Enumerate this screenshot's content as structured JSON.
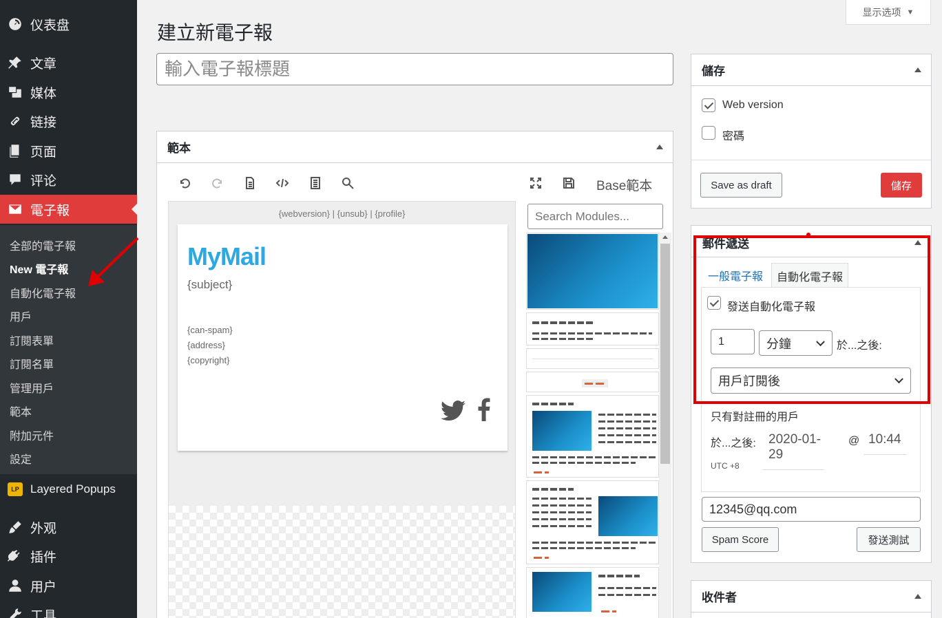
{
  "sidebar": {
    "menu": [
      {
        "label": "仪表盘",
        "icon": "dashboard-icon"
      },
      {
        "label": "文章",
        "icon": "pin-icon"
      },
      {
        "label": "媒体",
        "icon": "media-icon"
      },
      {
        "label": "链接",
        "icon": "link-icon"
      },
      {
        "label": "页面",
        "icon": "page-icon"
      },
      {
        "label": "评论",
        "icon": "comment-icon"
      },
      {
        "label": "電子報",
        "icon": "mail-icon"
      }
    ],
    "submenu": [
      "全部的電子報",
      "New 電子報",
      "自動化電子報",
      "用戶",
      "訂閱表單",
      "訂閱名單",
      "管理用戶",
      "範本",
      "附加元件",
      "設定"
    ],
    "layered_popups": {
      "label": "Layered Popups",
      "badge": "LP"
    },
    "menu_bottom": [
      {
        "label": "外观",
        "icon": "brush-icon"
      },
      {
        "label": "插件",
        "icon": "plugin-icon"
      },
      {
        "label": "用户",
        "icon": "user-icon"
      },
      {
        "label": "工具",
        "icon": "wrench-icon"
      }
    ]
  },
  "header": {
    "screen_options": "显示选项",
    "page_title": "建立新電子報",
    "title_placeholder": "輸入電子報標題"
  },
  "template": {
    "box_title": "範本",
    "base_label": "Base範本",
    "canvas_header": "{webversion} | {unsub} | {profile}",
    "logo": "MyMail",
    "subject": "{subject}",
    "footer_lines": [
      "{can-spam}",
      "{address}",
      "{copyright}"
    ],
    "search_placeholder": "Search Modules..."
  },
  "save": {
    "title": "儲存",
    "web_version": "Web version",
    "password": "密碼",
    "save_draft": "Save as draft",
    "save": "儲存"
  },
  "delivery": {
    "title": "郵件遞送",
    "tabs": [
      "一般電子報",
      "自動化電子報"
    ],
    "auto_send_label": "發送自動化電子報",
    "amount": "1",
    "unit": "分鐘",
    "after_label": "於...之後:",
    "trigger": "用戶訂閱後",
    "only_registered": "只有對註冊的用戶",
    "after_label2": "於...之後:",
    "date": "2020-01-29",
    "at": "@",
    "time": "10:44",
    "timezone": "UTC +8",
    "test_email": "12345@qq.com",
    "spam_score": "Spam Score",
    "send_test": "發送測試"
  },
  "recipients": {
    "title": "收件者"
  },
  "colors": {
    "accent": "#e03c3c",
    "sidebar": "#23282d",
    "highlight": "#e00000",
    "logo": "#2da8e0"
  }
}
